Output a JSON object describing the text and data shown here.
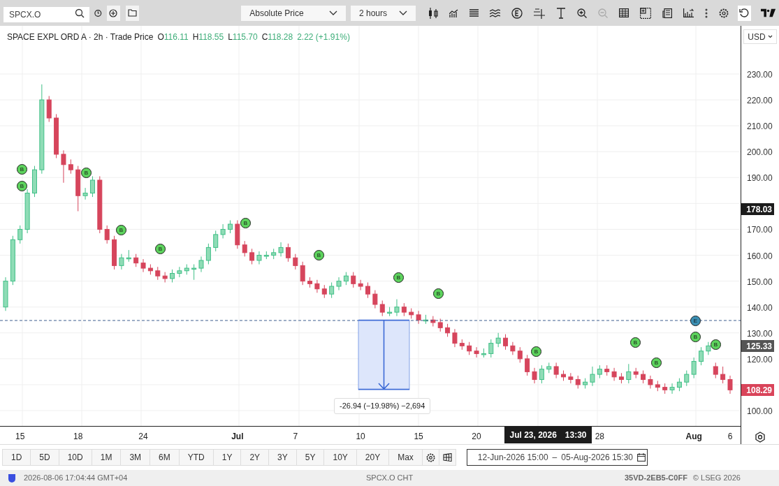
{
  "toolbar": {
    "search": {
      "value": "SPCX.O"
    },
    "dropdowns": [
      {
        "value": "Absolute Price"
      },
      {
        "value": "2 hours"
      }
    ]
  },
  "legend": {
    "title": "SPACE EXPL ORD A · 2h · Trade Price",
    "ohlc": [
      {
        "key": "O",
        "value": "116.11"
      },
      {
        "key": "H",
        "value": "118.55"
      },
      {
        "key": "L",
        "value": "115.70"
      },
      {
        "key": "C",
        "value": "118.28"
      }
    ],
    "change": "2.22 (+1.91%)"
  },
  "currency": "USD",
  "price_axis": {
    "labels": [
      {
        "text": "178.03",
        "kind": "crosshair"
      },
      {
        "text": "125.33",
        "kind": "last"
      },
      {
        "text": "108.29",
        "kind": "close"
      }
    ]
  },
  "time_axis": {
    "label_styles": [
      {
        "bold": false
      },
      {
        "bold": false
      },
      {
        "bold": false
      },
      {
        "bold": true
      },
      {
        "bold": false
      },
      {
        "bold": false
      },
      {
        "bold": false
      },
      {
        "bold": false
      },
      {
        "bold": false
      },
      {
        "bold": true
      },
      {
        "bold": false
      }
    ],
    "crosshair_label": {
      "date": "Jul 23, 2026",
      "time": "13:30"
    }
  },
  "chart": {
    "chart_data": {
      "type": "candlestick",
      "ylim": [
        93.8,
        248.6
      ],
      "grid": true,
      "ref_lines": [
        {
          "axis": "y",
          "value": 134.8
        }
      ],
      "categories": [
        null,
        null,
        "15",
        null,
        null,
        null,
        null,
        null,
        null,
        null,
        "18",
        null,
        null,
        null,
        null,
        null,
        null,
        null,
        null,
        "24",
        null,
        null,
        null,
        null,
        null,
        null,
        null,
        null,
        null,
        null,
        null,
        null,
        "Jul",
        null,
        null,
        null,
        null,
        null,
        null,
        null,
        "7",
        null,
        null,
        null,
        null,
        null,
        null,
        null,
        null,
        "10",
        null,
        null,
        null,
        null,
        null,
        null,
        null,
        "15",
        null,
        null,
        null,
        null,
        null,
        null,
        null,
        "20",
        null,
        null,
        null,
        null,
        null,
        null,
        null,
        null,
        null,
        null,
        null,
        null,
        null,
        null,
        null,
        null,
        "28",
        null,
        null,
        null,
        null,
        null,
        null,
        null,
        null,
        null,
        null,
        null,
        null,
        "Aug",
        null,
        null,
        null,
        null,
        "6"
      ],
      "yticks": [
        {
          "value": 230,
          "label": "230.00"
        },
        {
          "value": 220,
          "label": "220.00"
        },
        {
          "value": 210,
          "label": "210.00"
        },
        {
          "value": 200,
          "label": "200.00"
        },
        {
          "value": 190,
          "label": "190.00"
        },
        {
          "value": 170,
          "label": "170.00"
        },
        {
          "value": 160,
          "label": "160.00"
        },
        {
          "value": 150,
          "label": "150.00"
        },
        {
          "value": 140,
          "label": "140.00"
        },
        {
          "value": 130,
          "label": "130.00"
        },
        {
          "value": 120,
          "label": "120.00"
        },
        {
          "value": 100,
          "label": "100.00"
        }
      ],
      "ohlc": [
        [
          140,
          151.5,
          138.5,
          150
        ],
        [
          150,
          167.5,
          148.5,
          166
        ],
        [
          166,
          171.5,
          164.5,
          170
        ],
        [
          170,
          185.5,
          168.5,
          184
        ],
        [
          184,
          194.5,
          182.5,
          193
        ],
        [
          193,
          226,
          191.5,
          220
        ],
        [
          220,
          221.5,
          211.5,
          213
        ],
        [
          213,
          214.5,
          197.5,
          199
        ],
        [
          199,
          200.5,
          188,
          195
        ],
        [
          195,
          197,
          191.5,
          193
        ],
        [
          193,
          194.5,
          177,
          183
        ],
        [
          183,
          186,
          181.5,
          184
        ],
        [
          184,
          190.5,
          182.5,
          189
        ],
        [
          189,
          190.5,
          168.5,
          170
        ],
        [
          170,
          171.5,
          164.5,
          166
        ],
        [
          166,
          167.5,
          154.5,
          156
        ],
        [
          156,
          160.5,
          154.5,
          159
        ],
        [
          159,
          162,
          157.5,
          159
        ],
        [
          159,
          160.5,
          155.5,
          157
        ],
        [
          157,
          158.5,
          153.5,
          155
        ],
        [
          155,
          156.5,
          152.5,
          154
        ],
        [
          154,
          155.5,
          150.5,
          152
        ],
        [
          152,
          153.5,
          149.5,
          151
        ],
        [
          151,
          154.5,
          149.5,
          153
        ],
        [
          153,
          155.5,
          151.5,
          154
        ],
        [
          154,
          156.5,
          152.5,
          155
        ],
        [
          155,
          156.5,
          150.5,
          155
        ],
        [
          155,
          159.5,
          153.5,
          158
        ],
        [
          158,
          164.5,
          156.5,
          163
        ],
        [
          163,
          169.5,
          161.5,
          168
        ],
        [
          168,
          172,
          166.5,
          170
        ],
        [
          170,
          173.5,
          168.5,
          172
        ],
        [
          172,
          173.5,
          162.5,
          164
        ],
        [
          164,
          165.5,
          159.5,
          161
        ],
        [
          161,
          162.5,
          156.5,
          158
        ],
        [
          158,
          161.5,
          156.5,
          160
        ],
        [
          160,
          161.5,
          158.5,
          160
        ],
        [
          160,
          162.5,
          158.5,
          161
        ],
        [
          161,
          165,
          159.5,
          163
        ],
        [
          163,
          164.5,
          157.5,
          159
        ],
        [
          159,
          160.5,
          154.5,
          156
        ],
        [
          156,
          157.5,
          148.5,
          150
        ],
        [
          150,
          151.5,
          147.5,
          149
        ],
        [
          149,
          150.5,
          145.5,
          147
        ],
        [
          147,
          148.5,
          143.5,
          145
        ],
        [
          145,
          149.5,
          143.5,
          148
        ],
        [
          148,
          151.5,
          146.5,
          150
        ],
        [
          150,
          153.5,
          148.5,
          152
        ],
        [
          152,
          153.5,
          147.5,
          149
        ],
        [
          149,
          150.5,
          146.5,
          148
        ],
        [
          148,
          149.5,
          143.5,
          145
        ],
        [
          145,
          146.5,
          139.5,
          141
        ],
        [
          141,
          142.5,
          136.5,
          138
        ],
        [
          138,
          140,
          136.5,
          138
        ],
        [
          138,
          143,
          136.5,
          140
        ],
        [
          140,
          141.5,
          136.5,
          138
        ],
        [
          138,
          139.5,
          135.5,
          137
        ],
        [
          137,
          138.5,
          133.5,
          135
        ],
        [
          135,
          137,
          133.5,
          135
        ],
        [
          135,
          136.5,
          132.5,
          134
        ],
        [
          134,
          135.5,
          130.5,
          132
        ],
        [
          132,
          133.5,
          128.5,
          130
        ],
        [
          130,
          131.5,
          124.5,
          126
        ],
        [
          126,
          127.5,
          123.5,
          125
        ],
        [
          125,
          126.5,
          121.5,
          123
        ],
        [
          123,
          124.5,
          120.5,
          122
        ],
        [
          122,
          124,
          120.5,
          122
        ],
        [
          122,
          127.5,
          120.5,
          126
        ],
        [
          126,
          130,
          124.5,
          128
        ],
        [
          128,
          129.5,
          123.5,
          125
        ],
        [
          125,
          126.5,
          121.5,
          123
        ],
        [
          123,
          124.5,
          118.5,
          120
        ],
        [
          120,
          121.5,
          113.5,
          115
        ],
        [
          115,
          116.5,
          110.5,
          112
        ],
        [
          112,
          117.5,
          110.5,
          116
        ],
        [
          116,
          118.5,
          114.5,
          117
        ],
        [
          117,
          118.5,
          112.5,
          114
        ],
        [
          114,
          115.5,
          111.5,
          113
        ],
        [
          113,
          114.5,
          110.5,
          112
        ],
        [
          112,
          113.5,
          108.5,
          110
        ],
        [
          110,
          112.5,
          108.5,
          111
        ],
        [
          111,
          117,
          109.5,
          114
        ],
        [
          114,
          117.5,
          112.5,
          116
        ],
        [
          116,
          117.5,
          113.5,
          115
        ],
        [
          115,
          116.5,
          111.5,
          113
        ],
        [
          113,
          114.5,
          110.5,
          112
        ],
        [
          112,
          118,
          110.5,
          115
        ],
        [
          115,
          116.5,
          112.5,
          114
        ],
        [
          114,
          115.5,
          110.5,
          112
        ],
        [
          112,
          113.5,
          108.5,
          110
        ],
        [
          110,
          111.5,
          107.5,
          109
        ],
        [
          109,
          110.5,
          106.5,
          108
        ],
        [
          108,
          110.5,
          106.5,
          109
        ],
        [
          109,
          112.5,
          107.5,
          111
        ],
        [
          111,
          115.5,
          109.5,
          114
        ],
        [
          114,
          120.5,
          112.5,
          119
        ],
        [
          119,
          124.5,
          117.5,
          123
        ],
        [
          123,
          126.5,
          121.5,
          125
        ],
        [
          117,
          118.5,
          112.5,
          114
        ],
        [
          114,
          117,
          110.5,
          112
        ],
        [
          112,
          113.5,
          106.5,
          108
        ]
      ]
    }
  },
  "markers": [
    {
      "label": "B",
      "kind": "buy"
    },
    {
      "label": "B",
      "kind": "buy"
    },
    {
      "label": "B",
      "kind": "buy"
    },
    {
      "label": "B",
      "kind": "buy"
    },
    {
      "label": "B",
      "kind": "buy"
    },
    {
      "label": "B",
      "kind": "buy"
    },
    {
      "label": "B",
      "kind": "buy"
    },
    {
      "label": "B",
      "kind": "buy"
    },
    {
      "label": "B",
      "kind": "buy"
    },
    {
      "label": "B",
      "kind": "buy"
    },
    {
      "label": "B",
      "kind": "buy"
    },
    {
      "label": "B",
      "kind": "buy"
    },
    {
      "label": "B",
      "kind": "buy"
    },
    {
      "label": "B",
      "kind": "buy"
    },
    {
      "label": "E",
      "kind": "event"
    }
  ],
  "measurement": {
    "label": "-26.94 (−19.98%) −2,694"
  },
  "ranges": [
    "1D",
    "5D",
    "10D",
    "1M",
    "3M",
    "6M",
    "YTD",
    "1Y",
    "2Y",
    "3Y",
    "5Y",
    "10Y",
    "20Y",
    "Max"
  ],
  "date_range": {
    "from": "12-Jun-2026 15:00",
    "separator": "–",
    "to": "05-Aug-2026 15:30"
  },
  "status_bar": {
    "timestamp": "2026-08-06 17:04:44 GMT+04",
    "center": "SPCX.O CHT",
    "code": "35VD-2EB5-C0FF",
    "copyright": "© LSEG 2026"
  }
}
